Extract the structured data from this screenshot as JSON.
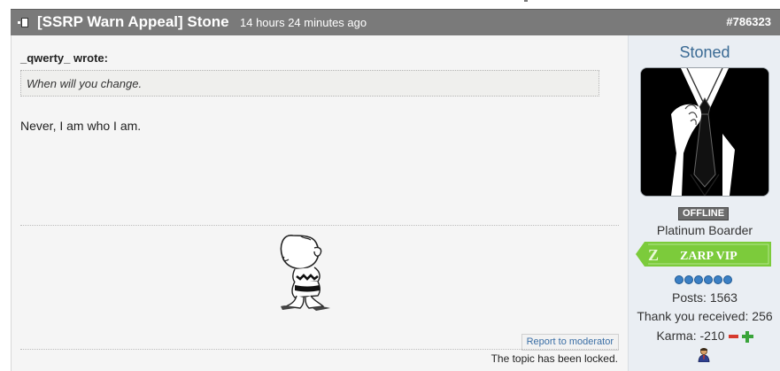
{
  "post": {
    "title": "[SSRP Warn Appeal] Stone",
    "time": "14 hours 24 minutes ago",
    "number": "#786323",
    "quote_author": "_qwerty_ wrote:",
    "quote_text": "When will you change.",
    "reply": "Never, I am who I am.",
    "report_label": "Report to moderator",
    "locked_text": "The topic has been locked."
  },
  "profile": {
    "username": "Stoned",
    "status": "OFFLINE",
    "rank": "Platinum Boarder",
    "badge": "ZARP VIP",
    "badge_letter": "Z",
    "rank_dots": 6,
    "posts": "Posts: 1563",
    "thanks": "Thank you received: 256",
    "karma": "Karma: -210"
  },
  "colors": {
    "header": "#7a7a7a",
    "link": "#3a6a94",
    "badge_green": "#7ccb3b",
    "minus": "#d63a2e",
    "plus": "#3aa43a"
  },
  "icons": [
    "post-icon",
    "avatar-image",
    "snoopy-signature-image",
    "zarp-vip-badge",
    "rank-dot-icon",
    "karma-minus-icon",
    "karma-plus-icon",
    "user-profile-icon"
  ]
}
